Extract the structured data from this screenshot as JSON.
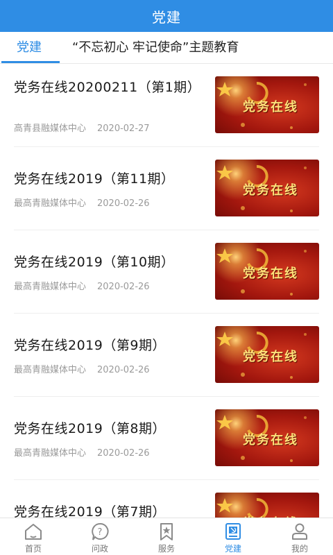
{
  "header": {
    "title": "党建"
  },
  "tabs": [
    {
      "label": "党建"
    },
    {
      "label": "“不忘初心 牢记使命”主题教育"
    }
  ],
  "thumbnail_text": "党务在线",
  "items": [
    {
      "title": "党务在线20200211（第1期）",
      "source": "高青县融媒体中心",
      "date": "2020-02-27"
    },
    {
      "title": "党务在线2019（第11期）",
      "source": "最高青融媒体中心",
      "date": "2020-02-26"
    },
    {
      "title": "党务在线2019（第10期）",
      "source": "最高青融媒体中心",
      "date": "2020-02-26"
    },
    {
      "title": "党务在线2019（第9期）",
      "source": "最高青融媒体中心",
      "date": "2020-02-26"
    },
    {
      "title": "党务在线2019（第8期）",
      "source": "最高青融媒体中心",
      "date": "2020-02-26"
    },
    {
      "title": "党务在线2019（第7期）",
      "source": "",
      "date": ""
    }
  ],
  "bottom_nav": [
    {
      "label": "首页",
      "icon": "home-icon"
    },
    {
      "label": "问政",
      "icon": "question-icon"
    },
    {
      "label": "服务",
      "icon": "bookmark-star-icon"
    },
    {
      "label": "党建",
      "icon": "party-flag-icon",
      "active": true
    },
    {
      "label": "我的",
      "icon": "user-icon"
    }
  ],
  "colors": {
    "accent": "#2f8de4",
    "text": "#1a1a1a",
    "meta": "#9a9a9a"
  }
}
